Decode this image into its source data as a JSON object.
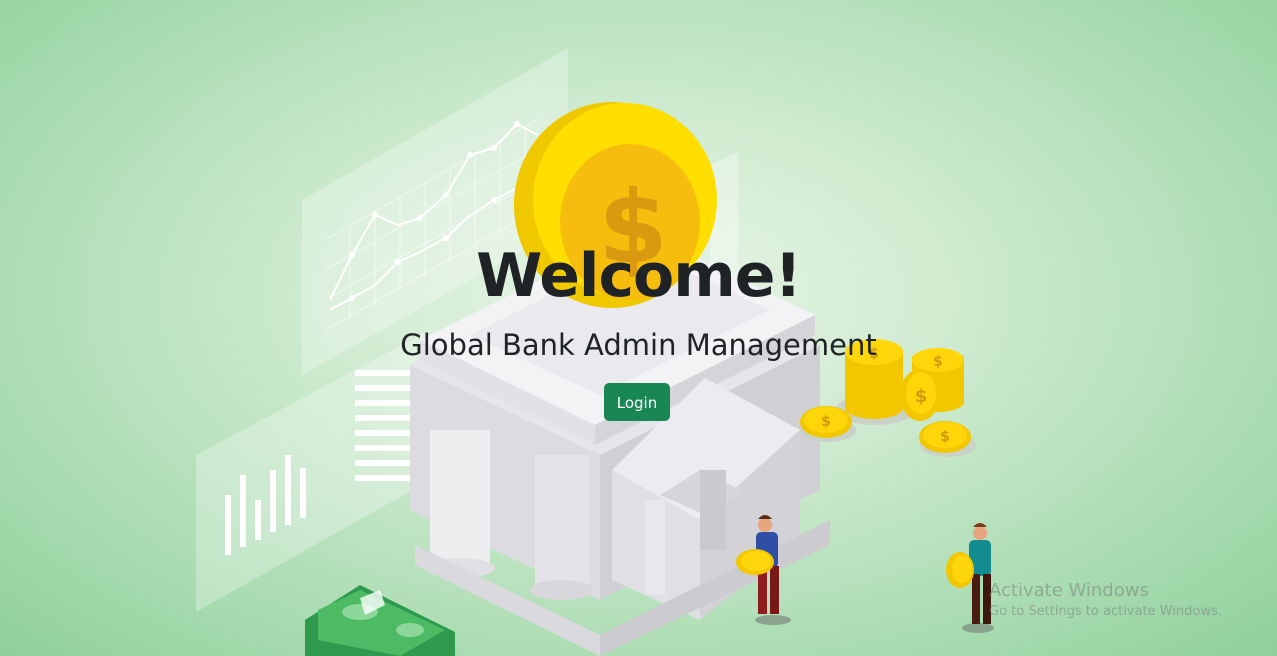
{
  "hero": {
    "title": "Welcome!",
    "subtitle": "Global Bank Admin Management",
    "login_label": "Login"
  },
  "watermark": {
    "title": "Activate Windows",
    "subtitle": "Go to Settings to activate Windows."
  },
  "colors": {
    "background": "#a8dbb0",
    "button": "#198754",
    "coin": "#f7d10a",
    "cash": "#3aa85a",
    "text": "#1f2326"
  },
  "icons": [
    "dollar-coin-icon",
    "bank-building-icon",
    "line-chart-icon",
    "bar-chart-icon",
    "cash-stack-icon",
    "person-icon"
  ]
}
